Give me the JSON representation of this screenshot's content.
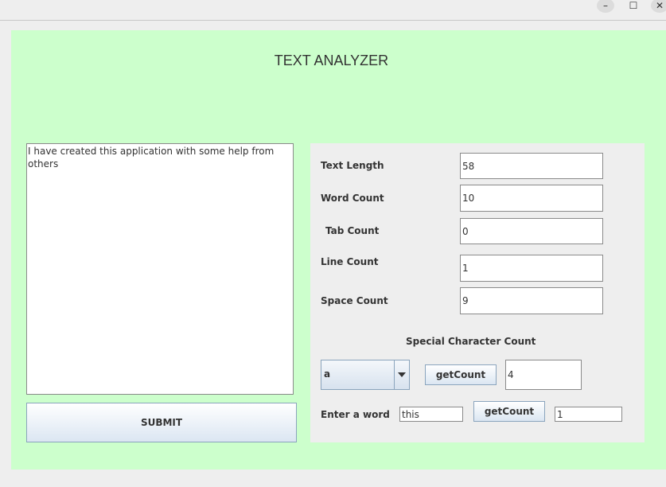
{
  "window": {
    "title": "TEXT ANALYZER",
    "controls": {
      "minimize": "–",
      "maximize": "☐",
      "close": "✕"
    }
  },
  "input": {
    "text": "I have created this application with some help from others"
  },
  "submit_label": "SUBMIT",
  "stats": [
    {
      "label": "Text Length",
      "value": "58"
    },
    {
      "label": "Word Count",
      "value": "10"
    },
    {
      "label": "Tab Count",
      "value": "0"
    },
    {
      "label": "Line Count",
      "value": "1"
    },
    {
      "label": "Space Count",
      "value": "9"
    }
  ],
  "special": {
    "heading": "Special Character Count",
    "selected_char": "a",
    "button_label": "getCount",
    "result": "4"
  },
  "word_search": {
    "label": "Enter a word",
    "value": "this",
    "button_label": "getCount",
    "result": "1"
  }
}
